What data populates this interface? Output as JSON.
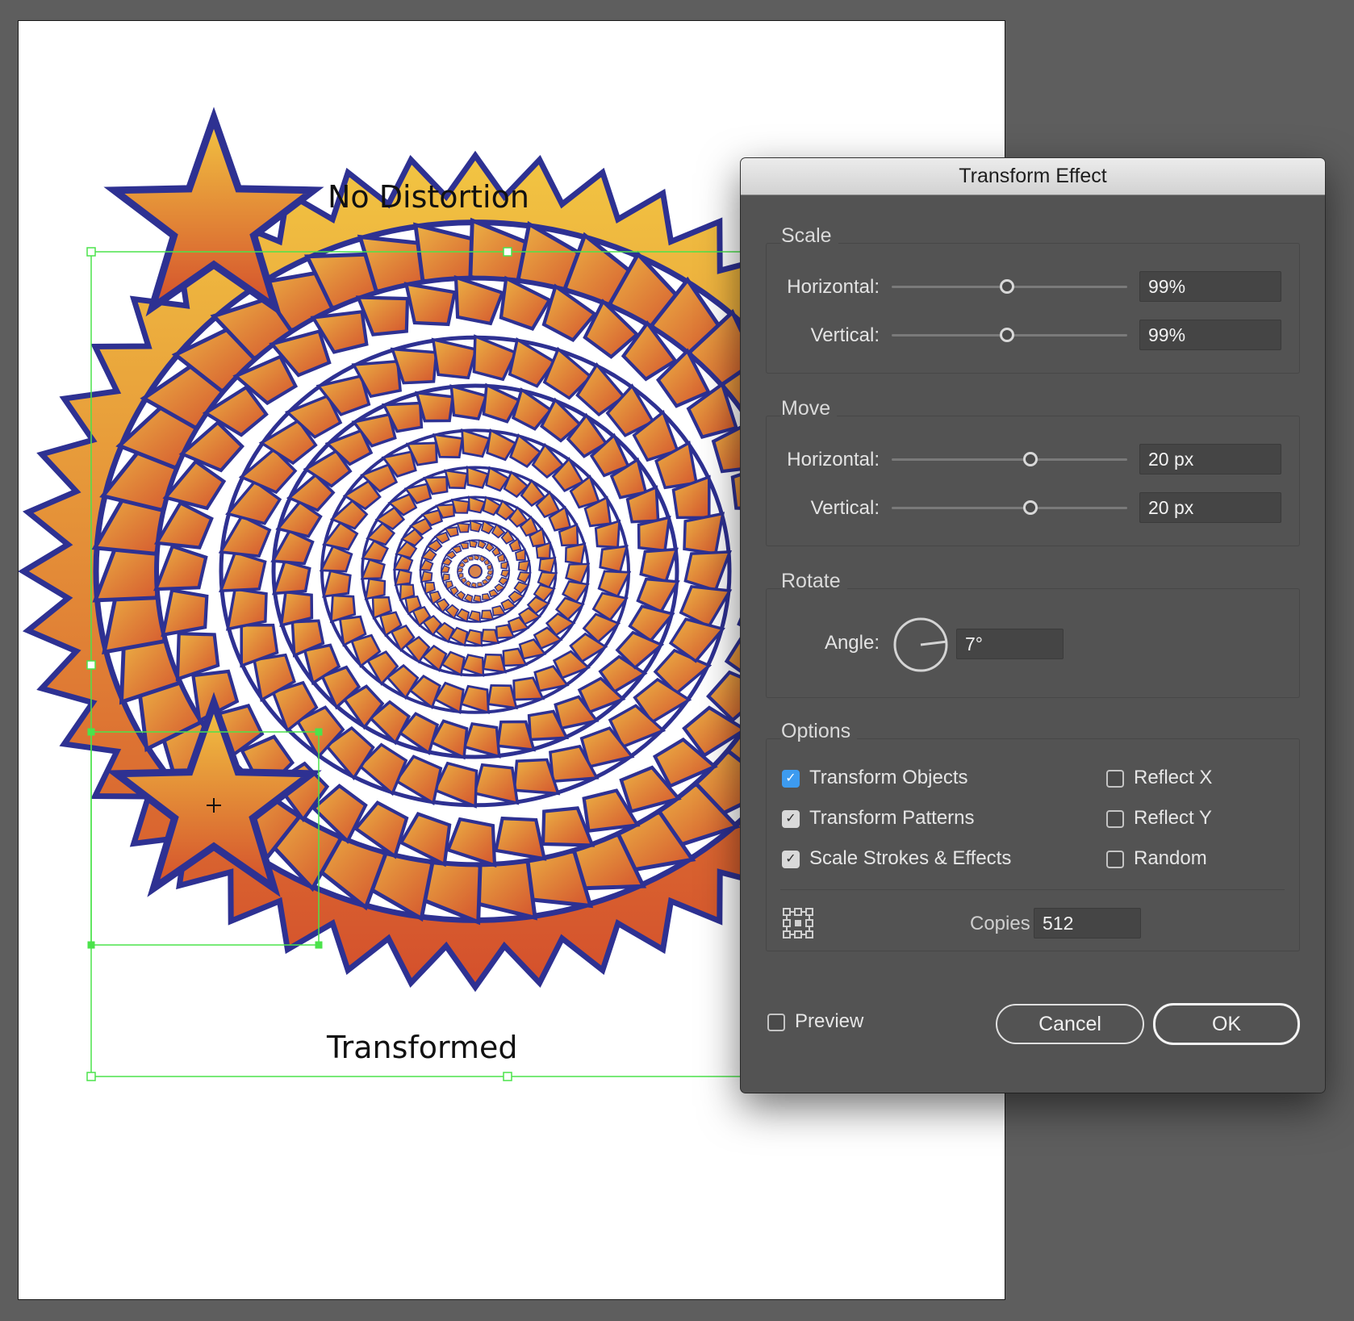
{
  "artboard": {
    "label_top": "No Distortion",
    "label_bottom": "Transformed",
    "colors": {
      "gradient_top": "#f2c542",
      "gradient_bottom": "#d4502c",
      "stroke": "#2e3192",
      "selection": "#4be34b"
    }
  },
  "dialog": {
    "title": "Transform Effect",
    "scale": {
      "title": "Scale",
      "horizontal_label": "Horizontal:",
      "horizontal_value": "99%",
      "horizontal_slider": 0.49,
      "vertical_label": "Vertical:",
      "vertical_value": "99%",
      "vertical_slider": 0.49
    },
    "move": {
      "title": "Move",
      "horizontal_label": "Horizontal:",
      "horizontal_value": "20 px",
      "horizontal_slider": 0.59,
      "vertical_label": "Vertical:",
      "vertical_value": "20 px",
      "vertical_slider": 0.59
    },
    "rotate": {
      "title": "Rotate",
      "angle_label": "Angle:",
      "angle_value": "7°",
      "angle_degrees": 7
    },
    "options": {
      "title": "Options",
      "transform_objects": {
        "label": "Transform Objects",
        "checked": true
      },
      "transform_patterns": {
        "label": "Transform Patterns",
        "checked": true
      },
      "scale_strokes": {
        "label": "Scale Strokes & Effects",
        "checked": true
      },
      "reflect_x": {
        "label": "Reflect X",
        "checked": false
      },
      "reflect_y": {
        "label": "Reflect Y",
        "checked": false
      },
      "random": {
        "label": "Random",
        "checked": false
      },
      "copies_label": "Copies",
      "copies_value": "512"
    },
    "preview": {
      "label": "Preview",
      "checked": false
    },
    "cancel_label": "Cancel",
    "ok_label": "OK"
  }
}
